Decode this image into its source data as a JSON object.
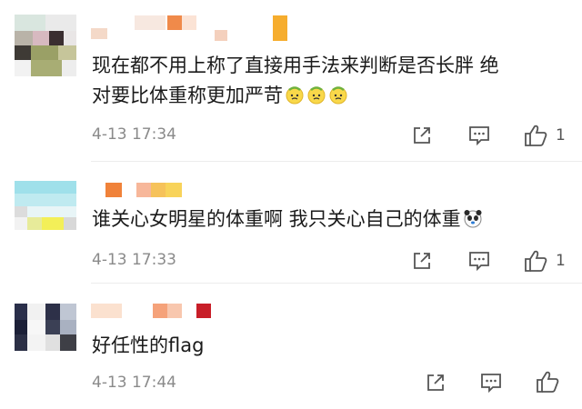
{
  "comments": [
    {
      "text_line1": "现在都不用上称了直接用手法来判断是否长胖 绝",
      "text_line2": "对要比体重称更加严苛",
      "timestamp": "4-13 17:34",
      "like_count": "1",
      "emojis": [
        "sweat-face-emoji",
        "sweat-face-emoji",
        "sweat-face-emoji"
      ]
    },
    {
      "text_line1": "谁关心女明星的体重啊 我只关心自己的体重",
      "timestamp": "4-13 17:33",
      "like_count": "1",
      "emojis": [
        "panda-face-emoji"
      ]
    },
    {
      "text_line1": "好任性的flag",
      "timestamp": "4-13 17:44",
      "like_count": "",
      "emojis": []
    }
  ],
  "icons": {
    "share": "share-icon",
    "comment": "comment-icon",
    "like": "thumbs-up-icon"
  },
  "colors": {
    "text": "#1a1a1a",
    "meta": "#8a8a8a",
    "icon": "#555555"
  }
}
